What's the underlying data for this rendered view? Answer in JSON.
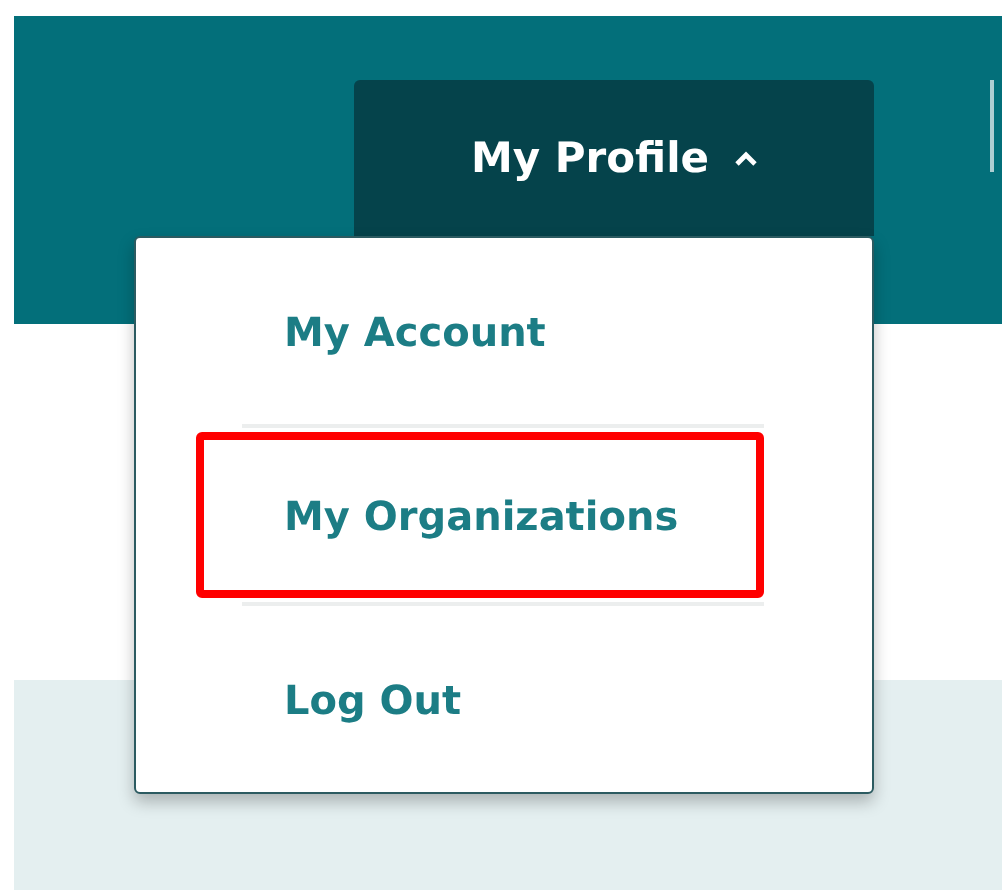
{
  "header": {
    "profile_button": {
      "label": "My Profile",
      "expanded": true
    }
  },
  "menu": {
    "items": [
      {
        "label": "My Account",
        "highlighted": false
      },
      {
        "label": "My Organizations",
        "highlighted": true
      },
      {
        "label": "Log Out",
        "highlighted": false
      }
    ]
  }
}
